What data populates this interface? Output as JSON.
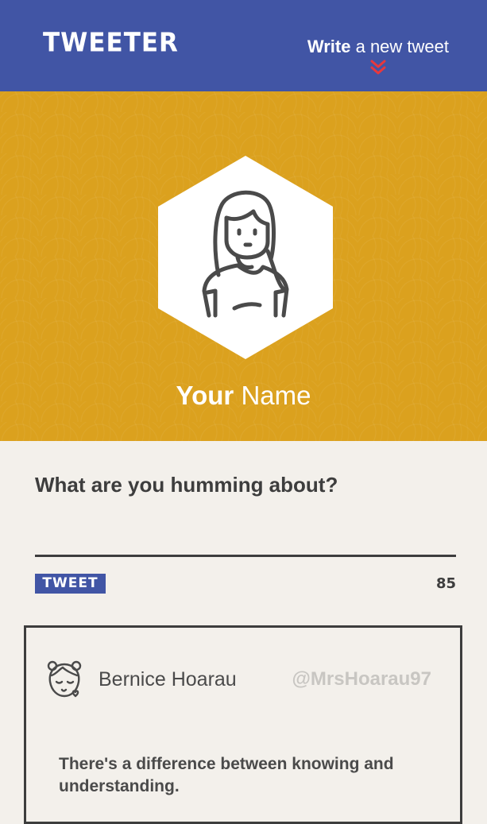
{
  "header": {
    "logo": "TWEETER",
    "write_strong": "Write",
    "write_light": "a new tweet",
    "chevron_color": "#e8383d"
  },
  "profile": {
    "name_strong": "Your",
    "name_light": "Name",
    "avatar_icon": "woman-avatar-icon"
  },
  "composer": {
    "label": "What are you humming about?",
    "input_value": "",
    "button_label": "TWEET",
    "char_count": "85"
  },
  "tweets": [
    {
      "name": "Bernice Hoarau",
      "handle": "@MrsHoarau97",
      "text": "There's a difference between knowing and understanding.",
      "avatar_icon": "girl-avatar-icon"
    }
  ],
  "colors": {
    "header_bg": "#4155a5",
    "banner_bg": "#dba11e",
    "page_bg": "#f3f0eb",
    "text_dark": "#3d3d3d",
    "handle_gray": "#c8c6c2"
  }
}
